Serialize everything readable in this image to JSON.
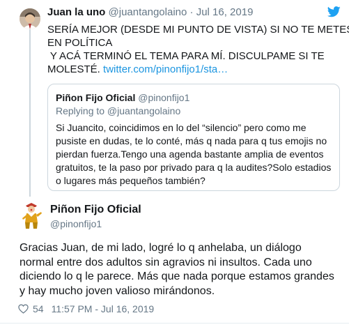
{
  "reply_tweet": {
    "name": "Juan la uno",
    "handle": "@juantangolaino",
    "separator": "·",
    "date": "Jul 16, 2019",
    "text_lines": [
      "SERÍA MEJOR (DESDE MI PUNTO DE VISTA) SI NO TE METES",
      "EN POLÍTICA",
      " Y ACÁ TERMINÓ EL TEMA PARA MÍ. DISCULPAME SI TE",
      "MOLESTÉ. "
    ],
    "link": "twitter.com/pinonfijo1/sta…",
    "icons": {
      "avatar": "avatar-photo",
      "brand": "twitter-bird-icon"
    },
    "brand_color": "#1da1f2"
  },
  "quoted_tweet": {
    "name": "Piñon Fijo Oficial",
    "handle": "@pinonfijo1",
    "replying_to": "Replying to @juantangolaino",
    "text_lines": [
      "Si Juancito, coincidimos en lo del “silencio” pero como me",
      "pusiste en dudas, te lo conté, más q nada para q tus emojis no",
      "pierdan fuerza.Tengo una agenda bastante amplia de eventos",
      "gratuitos, te la paso por privado para q la audites?Solo estadios",
      "o lugares más pequeños también?"
    ]
  },
  "main_tweet": {
    "name": "Piñon Fijo Oficial",
    "handle": "@pinonfijo1",
    "text_lines": [
      "Gracias Juan, de mi lado, logré lo q anhelaba, un diálogo",
      "normal entre dos adultos sin agravios ni insultos. Cada uno",
      "diciendo lo q le parece. Más que nada porque estamos grandes",
      "y hay mucho joven valioso mirándonos."
    ],
    "likes": "54",
    "timestamp": "11:57 PM - Jul 16, 2019",
    "icons": {
      "avatar": "avatar-clown",
      "like": "heart-icon"
    }
  },
  "colors": {
    "text": "#14171a",
    "secondary": "#657786",
    "link": "#1b95e0",
    "border": "#ccd6dd"
  }
}
